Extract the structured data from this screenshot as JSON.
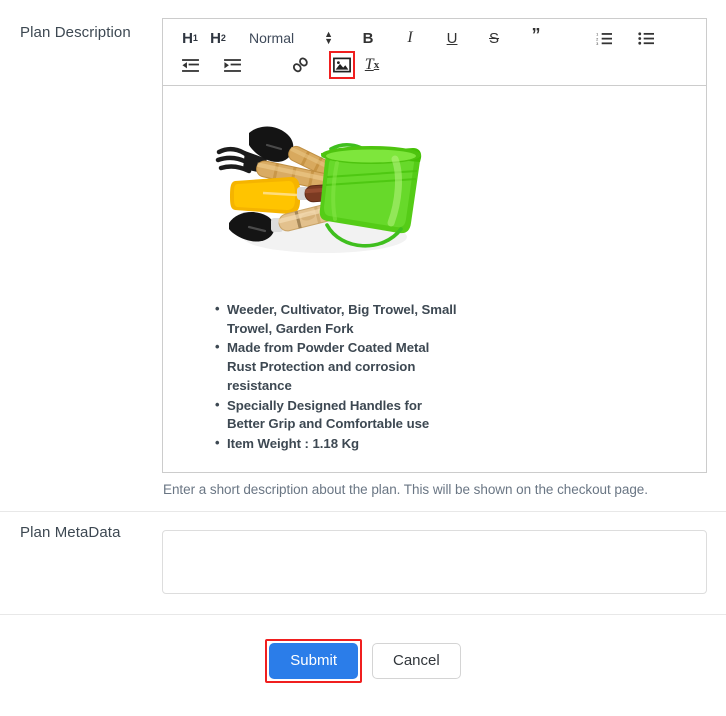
{
  "form": {
    "description_label": "Plan Description",
    "metadata_label": "Plan MetaData",
    "help_text": "Enter a short description about the plan. This will be shown on the checkout page.",
    "metadata_value": "",
    "metadata_placeholder": ""
  },
  "toolbar": {
    "h1_label": "H",
    "h1_sub": "1",
    "h2_label": "H",
    "h2_sub": "2",
    "format_selected": "Normal",
    "bold_label": "B",
    "italic_label": "I",
    "underline_label": "U",
    "strike_label": "S",
    "quote_label": "”",
    "clear_label": "T",
    "clear_sub": "x",
    "items": [
      {
        "name": "header-1",
        "label": "H1"
      },
      {
        "name": "header-2",
        "label": "H2"
      },
      {
        "name": "format-picker",
        "label": "Normal"
      },
      {
        "name": "bold",
        "label": "Bold"
      },
      {
        "name": "italic",
        "label": "Italic"
      },
      {
        "name": "underline",
        "label": "Underline"
      },
      {
        "name": "strike",
        "label": "Strikethrough"
      },
      {
        "name": "blockquote",
        "label": "Blockquote"
      },
      {
        "name": "ordered-list",
        "label": "Ordered List"
      },
      {
        "name": "bullet-list",
        "label": "Bullet List"
      },
      {
        "name": "outdent",
        "label": "Outdent"
      },
      {
        "name": "indent",
        "label": "Indent"
      },
      {
        "name": "link",
        "label": "Link"
      },
      {
        "name": "image",
        "label": "Image"
      },
      {
        "name": "clear-format",
        "label": "Clear Formatting"
      }
    ]
  },
  "editor_content": {
    "image_alt": "Garden tool set with green bucket, yellow shovel and trowels",
    "bullets": [
      "Weeder, Cultivator, Big Trowel, Small Trowel, Garden Fork",
      "Made from Powder Coated Metal Rust Protection and corrosion resistance",
      "Specially Designed Handles for Better Grip and Comfortable use",
      "Item Weight : 1.18 Kg"
    ]
  },
  "footer": {
    "submit_label": "Submit",
    "cancel_label": "Cancel"
  },
  "colors": {
    "primary": "#2b7de9",
    "highlight": "#f01f1f",
    "text": "#3d4852",
    "muted": "#6a7684",
    "border": "#cccccc"
  }
}
